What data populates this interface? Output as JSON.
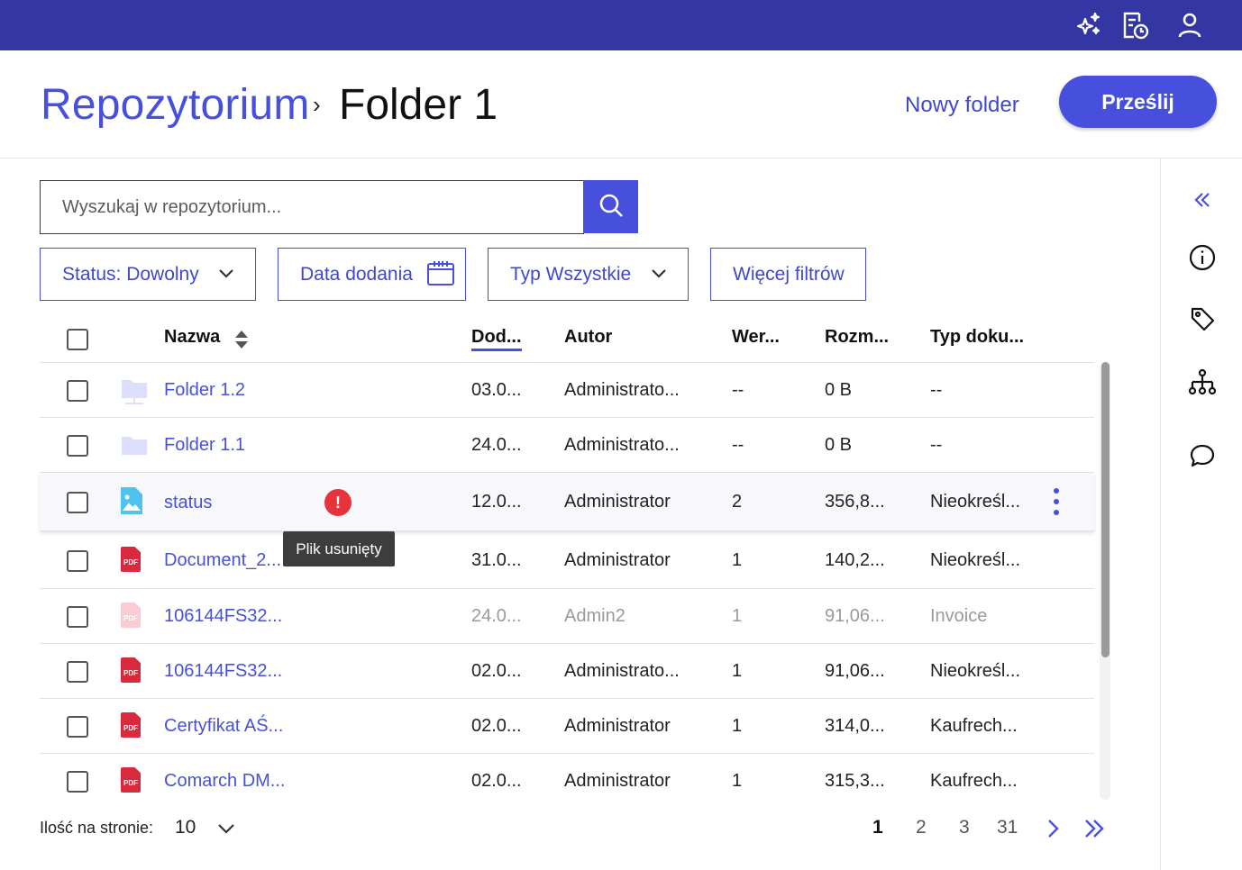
{
  "topbar": {
    "icons": [
      "sparkles-icon",
      "document-clock-icon",
      "user-icon"
    ],
    "bg_color": "#3436a3"
  },
  "header": {
    "breadcrumb_root": "Repozytorium",
    "breadcrumb_separator": "›",
    "breadcrumb_current": "Folder 1",
    "new_folder_label": "Nowy folder",
    "upload_label": "Prześlij",
    "accent_color": "#4650dc"
  },
  "search": {
    "placeholder": "Wyszukaj w repozytorium...",
    "value": ""
  },
  "filters": {
    "status": "Status: Dowolny",
    "date_added": "Data dodania",
    "type": "Typ Wszystkie",
    "more": "Więcej filtrów"
  },
  "table": {
    "columns": {
      "name": "Nazwa",
      "date": "Dod...",
      "author": "Autor",
      "version": "Wer...",
      "size": "Rozm...",
      "doc_type": "Typ doku..."
    },
    "rows": [
      {
        "icon": "shared-folder-icon",
        "name": "Folder 1.2",
        "date": "03.0...",
        "author": "Administrato...",
        "version": "--",
        "size": "0 B",
        "doc_type": "--"
      },
      {
        "icon": "folder-icon",
        "name": "Folder 1.1",
        "date": "24.0...",
        "author": "Administrato...",
        "version": "--",
        "size": "0 B",
        "doc_type": "--"
      },
      {
        "icon": "image-file-icon",
        "name": "status",
        "date": "12.0...",
        "author": "Administrator",
        "version": "2",
        "size": "356,8...",
        "doc_type": "Nieokreśl..."
      },
      {
        "icon": "pdf-file-icon",
        "name": "Document_2...",
        "date": "31.0...",
        "author": "Administrator",
        "version": "1",
        "size": "140,2...",
        "doc_type": "Nieokreśl..."
      },
      {
        "icon": "pdf-file-icon",
        "name": "106144FS32...",
        "date": "24.0...",
        "author": "Admin2",
        "version": "1",
        "size": "91,06...",
        "doc_type": "Invoice"
      },
      {
        "icon": "pdf-file-icon",
        "name": "106144FS32...",
        "date": "02.0...",
        "author": "Administrato...",
        "version": "1",
        "size": "91,06...",
        "doc_type": "Nieokreśl..."
      },
      {
        "icon": "pdf-file-icon",
        "name": "Certyfikat AŚ...",
        "date": "02.0...",
        "author": "Administrator",
        "version": "1",
        "size": "314,0...",
        "doc_type": "Kaufrech..."
      },
      {
        "icon": "pdf-file-icon",
        "name": "Comarch DM...",
        "date": "02.0...",
        "author": "Administrator",
        "version": "1",
        "size": "315,3...",
        "doc_type": "Kaufrech..."
      }
    ],
    "pdf_label": "PDF",
    "error_glyph": "!",
    "tooltip": "Plik usunięty"
  },
  "pagination": {
    "per_page_label": "Ilość na stronie:",
    "per_page_value": "10",
    "pages": [
      "1",
      "2",
      "3",
      "31"
    ],
    "current_page": "1"
  },
  "side_panel": {
    "icons": [
      "collapse-double-chevron-icon",
      "info-icon",
      "tag-icon",
      "hierarchy-icon",
      "comment-icon"
    ]
  }
}
